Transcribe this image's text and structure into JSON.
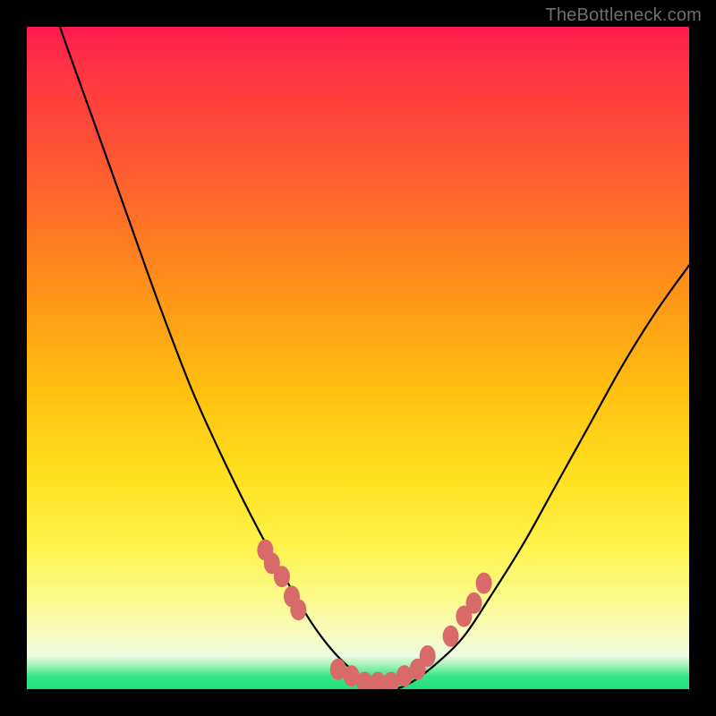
{
  "watermark": "TheBottleneck.com",
  "colors": {
    "frame": "#000000",
    "gradient_top": "#ff1a4d",
    "gradient_mid": "#ffe020",
    "gradient_bottom": "#1fe07a",
    "curve": "#000000",
    "marker_fill": "#d96a6a",
    "marker_stroke": "#d96a6a"
  },
  "chart_data": {
    "type": "line",
    "title": "",
    "xlabel": "",
    "ylabel": "",
    "xlim": [
      0,
      100
    ],
    "ylim": [
      0,
      100
    ],
    "grid": false,
    "legend": false,
    "series": [
      {
        "name": "bottleneck-curve",
        "x": [
          0,
          5,
          10,
          15,
          20,
          25,
          30,
          35,
          40,
          43,
          46,
          49,
          52,
          55,
          58,
          62,
          66,
          70,
          75,
          80,
          85,
          90,
          95,
          100
        ],
        "values": [
          115,
          100,
          86,
          72,
          58,
          45,
          34,
          24,
          15,
          10,
          6,
          3,
          1,
          0,
          1,
          4,
          8,
          14,
          22,
          31,
          40,
          49,
          57,
          64
        ]
      }
    ],
    "markers": {
      "name": "highlighted-points",
      "x": [
        36,
        37,
        38.5,
        40,
        41,
        47,
        49,
        51,
        53,
        55,
        57,
        59,
        60.5,
        64,
        66,
        67.5,
        69
      ],
      "values": [
        21,
        19,
        17,
        14,
        12,
        3,
        2,
        1,
        1,
        1,
        2,
        3,
        5,
        8,
        11,
        13,
        16
      ]
    }
  }
}
